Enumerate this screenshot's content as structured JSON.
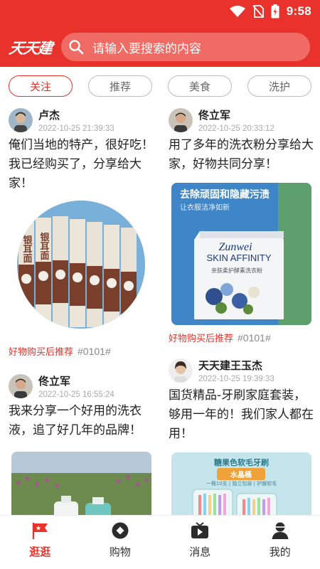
{
  "status_bar": {
    "time": "9:58"
  },
  "app": {
    "logo_text": "天天建"
  },
  "search": {
    "placeholder": "请输入要搜索的内容"
  },
  "filter_tabs": [
    {
      "label": "关注",
      "active": true
    },
    {
      "label": "推荐",
      "active": false
    },
    {
      "label": "美食",
      "active": false
    },
    {
      "label": "洗护",
      "active": false
    }
  ],
  "feed": {
    "left": [
      {
        "author": "卢杰",
        "date": "2022-10-25 21:39:33",
        "text": "俺们当地的特产，很好吃！我已经购买了，分享给大家！",
        "image_label": "银耳面",
        "tag": "好物购买后推荐",
        "hashtag": "#0101#"
      },
      {
        "author": "佟立军",
        "date": "2022-10-25 16:55:24",
        "text": "我来分享一个好用的洗衣液，追了好几年的品牌！"
      }
    ],
    "right": [
      {
        "author": "佟立军",
        "date": "2022-10-25 20:33:12",
        "text": "用了多年的洗衣粉分享给大家，好物共同分享！",
        "image_headline": "去除顽固和隐藏污渍",
        "image_sub": "让衣服洁净如新",
        "image_brand": "Zunwei",
        "image_product": "SKIN AFFINITY",
        "image_product_cn": "亲肤柔护酵素洗衣粉",
        "tag": "好物购买后推荐",
        "hashtag": "#0101#"
      },
      {
        "author": "天天建王玉杰",
        "date": "2022-10-25 19:39:33",
        "text": "国货精品-牙刷家庭套装，够用一年的！我们家人都在用！",
        "image_headline": "糖果色软毛牙刷",
        "image_badge": "水晶桶",
        "image_sub": "一桶10支 | 独立包装 | 护龈软毛"
      }
    ]
  },
  "bottom_nav": [
    {
      "label": "逛逛",
      "icon": "flag-icon",
      "active": true
    },
    {
      "label": "购物",
      "icon": "shopping-icon",
      "active": false
    },
    {
      "label": "消息",
      "icon": "tv-message-icon",
      "active": false
    },
    {
      "label": "我的",
      "icon": "person-icon",
      "active": false
    }
  ],
  "colors": {
    "brand_red": "#e8322b",
    "search_bg": "#ef6b63"
  }
}
